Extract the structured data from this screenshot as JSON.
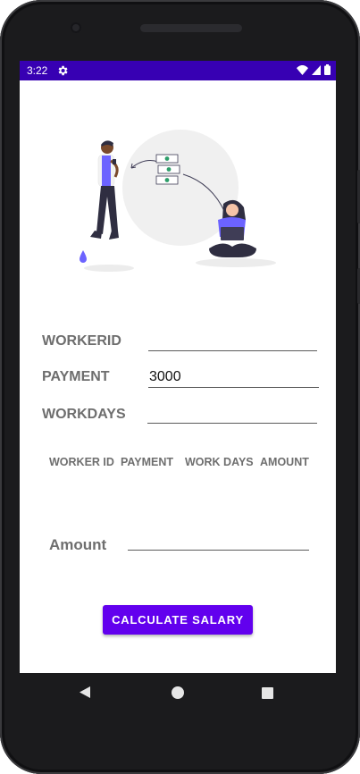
{
  "status_bar": {
    "time": "3:22",
    "icons": [
      "settings-gear-icon",
      "wifi-icon",
      "signal-icon",
      "battery-icon"
    ],
    "background_color": "#3700b3"
  },
  "form": {
    "worker_id": {
      "label": "WORKERID",
      "value": ""
    },
    "payment": {
      "label": "PAYMENT",
      "value": "3000"
    },
    "work_days": {
      "label": "WORKDAYS",
      "value": ""
    }
  },
  "table": {
    "headers": [
      "WORKER ID",
      "PAYMENT",
      "WORK DAYS",
      "AMOUNT"
    ]
  },
  "amount": {
    "label": "Amount",
    "value": ""
  },
  "actions": {
    "calculate_label": "CALCULATE SALARY",
    "accent_color": "#6200ee"
  },
  "nav_bar": {
    "icons": [
      "back-icon",
      "home-icon",
      "recents-icon"
    ]
  }
}
